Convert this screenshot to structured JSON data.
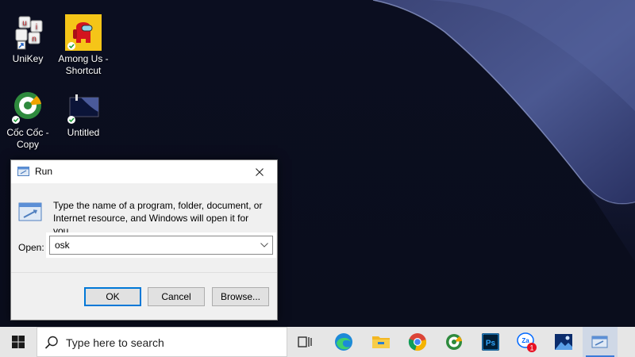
{
  "desktop": {
    "icons": [
      {
        "label": "UniKey"
      },
      {
        "label": "Among Us - Shortcut"
      },
      {
        "label": "Cốc Cốc - Copy"
      },
      {
        "label": "Untitled"
      }
    ]
  },
  "run_dialog": {
    "title": "Run",
    "description": "Type the name of a program, folder, document, or Internet resource, and Windows will open it for you.",
    "open_label": "Open:",
    "open_value": "osk",
    "ok_label": "OK",
    "cancel_label": "Cancel",
    "browse_label": "Browse..."
  },
  "taskbar": {
    "search_placeholder": "Type here to search",
    "zalo_badge": "1",
    "zalo_text": "Za",
    "photoshop_text": "Ps",
    "pinned": [
      "task-view-icon",
      "edge-icon",
      "file-explorer-icon",
      "chrome-icon",
      "coccoc-icon",
      "photoshop-icon",
      "zalo-icon",
      "photos-icon",
      "run-icon"
    ]
  },
  "colors": {
    "accent": "#0078d7",
    "taskbar": "#e6e6e6",
    "dialog": "#f0f0f0"
  }
}
